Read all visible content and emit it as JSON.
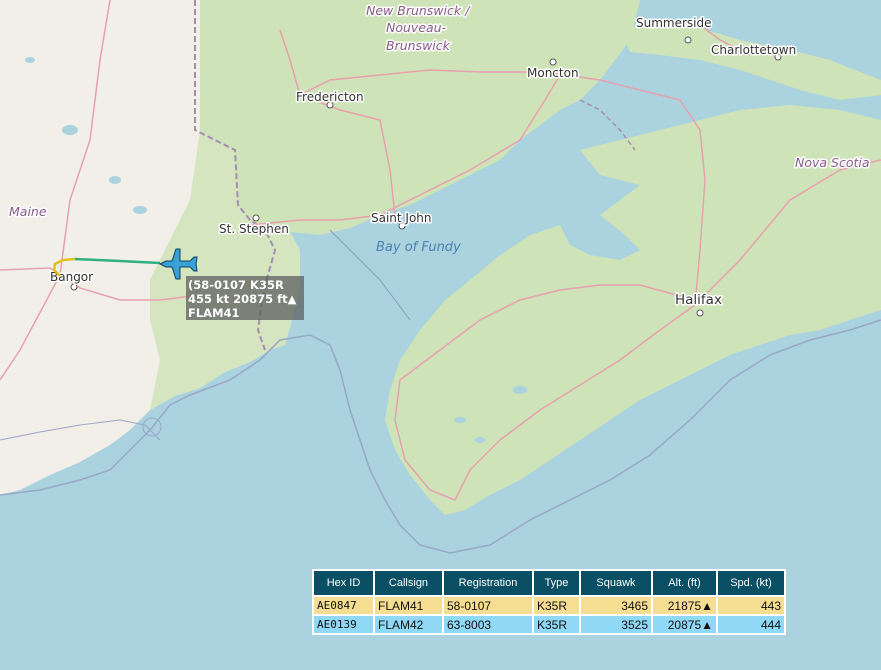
{
  "map": {
    "places": {
      "summerside": "Summerside",
      "charlottetown": "Charlottetown",
      "moncton": "Moncton",
      "fredericton": "Fredericton",
      "saint_john": "Saint John",
      "st_stephen": "St. Stephen",
      "halifax": "Halifax",
      "bangor": "Bangor"
    },
    "regions": {
      "new_brunswick_1": "New Brunswick /",
      "new_brunswick_2": "Nouveau-",
      "new_brunswick_3": "Brunswick",
      "maine": "Maine",
      "nova_scotia": "Nova Scotia"
    },
    "water": {
      "bay_of_fundy": "Bay of Fundy"
    },
    "colors": {
      "water": "#aad3df",
      "land": "#f2efe9",
      "forest": "#c8dfb0",
      "road": "#e892a2",
      "border": "#9e8aa6",
      "trail_yellow": "#e0c020",
      "trail_green": "#30b080",
      "aircraft": "#3aa0d8"
    }
  },
  "aircraft_label": {
    "line1": "(58-0107 K35R",
    "line2": "455 kt 20875 ft▲",
    "line3": "FLAM41"
  },
  "table": {
    "headers": [
      "Hex ID",
      "Callsign",
      "Registration",
      "Type",
      "Squawk",
      "Alt. (ft)",
      "Spd. (kt)"
    ],
    "rows": [
      {
        "hex": "AE0847",
        "callsign": "FLAM41",
        "registration": "58-0107",
        "type": "K35R",
        "squawk": "3465",
        "alt": "21875▲",
        "spd": "443"
      },
      {
        "hex": "AE0139",
        "callsign": "FLAM42",
        "registration": "63-8003",
        "type": "K35R",
        "squawk": "3525",
        "alt": "20875▲",
        "spd": "444"
      }
    ]
  }
}
